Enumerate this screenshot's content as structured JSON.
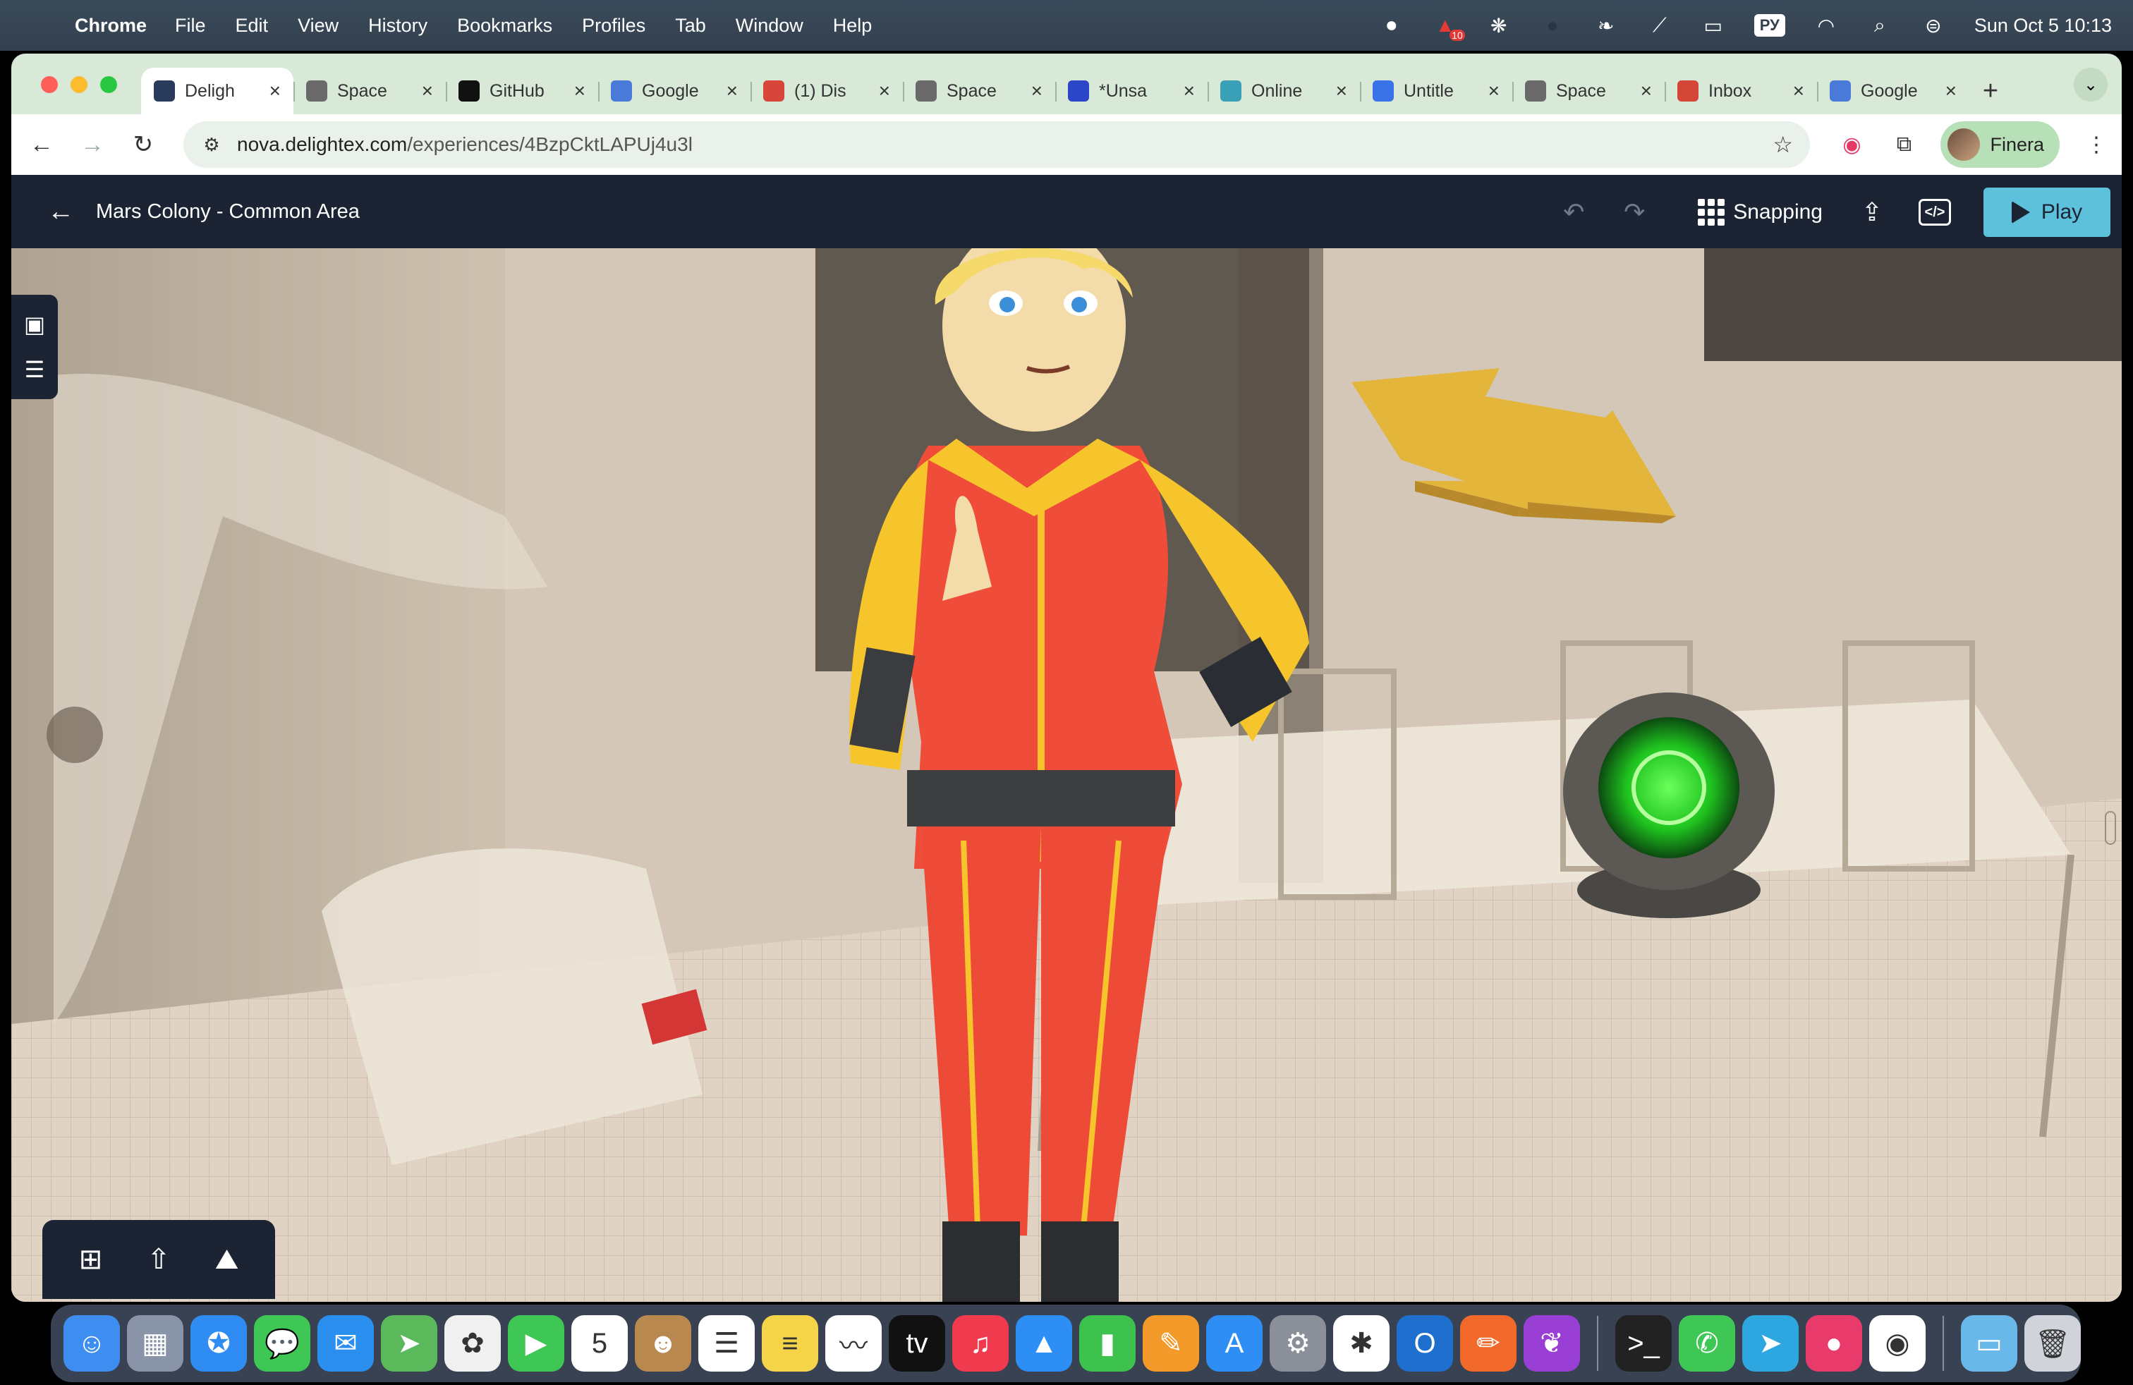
{
  "menubar": {
    "app_name": "Chrome",
    "items": [
      "File",
      "Edit",
      "View",
      "History",
      "Bookmarks",
      "Profiles",
      "Tab",
      "Window",
      "Help"
    ],
    "lang_badge": "РУ",
    "clock": "Sun Oct 5  10:13",
    "record_badge": "10"
  },
  "browser": {
    "tabs": [
      {
        "title": "Deligh",
        "favicon": "delightex-icon",
        "color": "#2a3a5a",
        "active": true
      },
      {
        "title": "Space",
        "favicon": "globe-icon",
        "color": "#6a6a6a"
      },
      {
        "title": "GitHub",
        "favicon": "github-icon",
        "color": "#111111"
      },
      {
        "title": "Google",
        "favicon": "gemini-icon",
        "color": "#4a7bd8"
      },
      {
        "title": "(1) Dis",
        "favicon": "discord-icon",
        "color": "#d8453a"
      },
      {
        "title": "Space",
        "favicon": "globe-icon",
        "color": "#6a6a6a"
      },
      {
        "title": "*Unsa",
        "favicon": "editor-icon",
        "color": "#2c46c8"
      },
      {
        "title": "Online",
        "favicon": "cloud-icon",
        "color": "#3aa0b8"
      },
      {
        "title": "Untitle",
        "favicon": "docs-icon",
        "color": "#3a72e8"
      },
      {
        "title": "Space",
        "favicon": "globe-icon",
        "color": "#6a6a6a"
      },
      {
        "title": "Inbox",
        "favicon": "gmail-icon",
        "color": "#d44638"
      },
      {
        "title": "Google",
        "favicon": "gemini-icon",
        "color": "#4a7bd8"
      }
    ],
    "new_tab_label": "+",
    "url_host": "nova.delightex.com",
    "url_path": "/experiences/4BzpCktLAPUj4u3l",
    "profile_name": "Finera"
  },
  "app": {
    "page_title": "Mars Colony - Common Area",
    "snapping_label": "Snapping",
    "play_label": "Play",
    "code_label": "</>"
  },
  "dock": {
    "apps": [
      {
        "name": "finder-icon",
        "color": "#3d8ef0",
        "glyph": "☺"
      },
      {
        "name": "launchpad-icon",
        "color": "#8a94a8",
        "glyph": "▦"
      },
      {
        "name": "safari-icon",
        "color": "#2f8cf3",
        "glyph": "✪"
      },
      {
        "name": "messages-icon",
        "color": "#3fc755",
        "glyph": "💬"
      },
      {
        "name": "mail-icon",
        "color": "#2b8ff0",
        "glyph": "✉"
      },
      {
        "name": "maps-icon",
        "color": "#5bb85b",
        "glyph": "➤"
      },
      {
        "name": "photos-icon",
        "color": "#f0f0f0",
        "glyph": "✿"
      },
      {
        "name": "facetime-icon",
        "color": "#3fc755",
        "glyph": "▶"
      },
      {
        "name": "calendar-icon",
        "color": "#ffffff",
        "glyph": "5"
      },
      {
        "name": "contacts-icon",
        "color": "#b8884e",
        "glyph": "☻"
      },
      {
        "name": "reminders-icon",
        "color": "#ffffff",
        "glyph": "☰"
      },
      {
        "name": "notes-icon",
        "color": "#f5d44a",
        "glyph": "≡"
      },
      {
        "name": "freeform-icon",
        "color": "#ffffff",
        "glyph": "〰"
      },
      {
        "name": "tv-icon",
        "color": "#111111",
        "glyph": "tv"
      },
      {
        "name": "music-icon",
        "color": "#f03a4e",
        "glyph": "♫"
      },
      {
        "name": "keynote-icon",
        "color": "#2d8ef5",
        "glyph": "▲"
      },
      {
        "name": "numbers-icon",
        "color": "#3cc24d",
        "glyph": "▮"
      },
      {
        "name": "pages-icon",
        "color": "#f39a2b",
        "glyph": "✎"
      },
      {
        "name": "app-store-icon",
        "color": "#2e8ef5",
        "glyph": "A"
      },
      {
        "name": "system-settings-icon",
        "color": "#8a8f98",
        "glyph": "⚙"
      },
      {
        "name": "slack-icon",
        "color": "#ffffff",
        "glyph": "✱"
      },
      {
        "name": "outlook-icon",
        "color": "#1f6fcf",
        "glyph": "O"
      },
      {
        "name": "pencil-app-icon",
        "color": "#f26a2b",
        "glyph": "✏"
      },
      {
        "name": "tulip-app-icon",
        "color": "#9a3fd6",
        "glyph": "❦"
      }
    ],
    "apps2": [
      {
        "name": "terminal-icon",
        "color": "#222222",
        "glyph": ">_"
      },
      {
        "name": "whatsapp-icon",
        "color": "#3fc755",
        "glyph": "✆"
      },
      {
        "name": "telegram-icon",
        "color": "#2ea6e0",
        "glyph": "➤"
      },
      {
        "name": "pink-app-icon",
        "color": "#e83a6b",
        "glyph": "●"
      },
      {
        "name": "chrome-icon",
        "color": "#ffffff",
        "glyph": "◉"
      }
    ],
    "apps3": [
      {
        "name": "downloads-folder-icon",
        "color": "#69b8ea",
        "glyph": "▭"
      },
      {
        "name": "trash-icon",
        "color": "#d0d4da",
        "glyph": "🗑"
      }
    ]
  }
}
